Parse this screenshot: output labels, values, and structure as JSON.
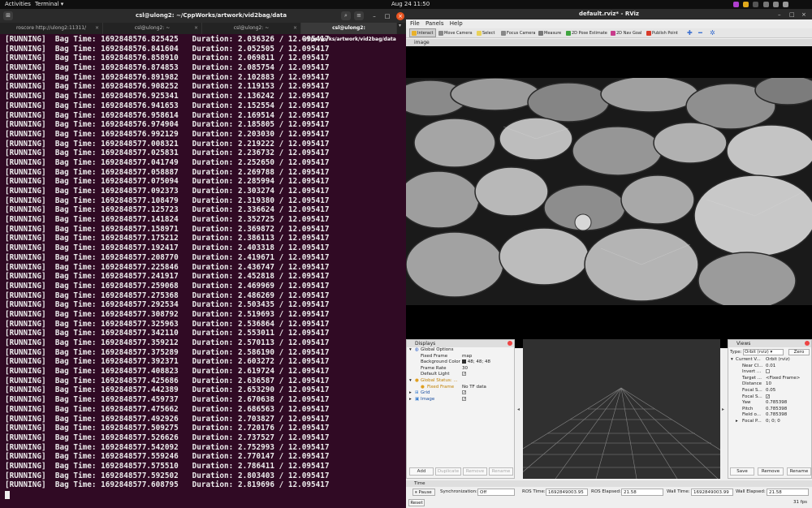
{
  "topbar": {
    "activities": "Activities",
    "app_menu": "Terminal ▾",
    "clock": "Aug 24  11:50"
  },
  "terminal": {
    "title": "csl@ulong2: ~/CppWorks/artwork/vid2bag/data",
    "tabs": [
      {
        "label": "roscore http://ulong2:11311/",
        "active": false
      },
      {
        "label": "csl@ulong2: ~",
        "active": false
      },
      {
        "label": "csl@ulong2: ~",
        "active": false
      },
      {
        "label": "csl@ulong2: ~/CppWorks/artwork/vid2bag/data",
        "active": true
      }
    ],
    "total_duration": "12.095417",
    "lines": [
      {
        "status": "[RUNNING]",
        "bag_time": "1692848576.825425",
        "duration": "2.036326"
      },
      {
        "status": "[RUNNING]",
        "bag_time": "1692848576.841604",
        "duration": "2.052505"
      },
      {
        "status": "[RUNNING]",
        "bag_time": "1692848576.858910",
        "duration": "2.069811"
      },
      {
        "status": "[RUNNING]",
        "bag_time": "1692848576.874853",
        "duration": "2.085754"
      },
      {
        "status": "[RUNNING]",
        "bag_time": "1692848576.891982",
        "duration": "2.102883"
      },
      {
        "status": "[RUNNING]",
        "bag_time": "1692848576.908252",
        "duration": "2.119153"
      },
      {
        "status": "[RUNNING]",
        "bag_time": "1692848576.925341",
        "duration": "2.136242"
      },
      {
        "status": "[RUNNING]",
        "bag_time": "1692848576.941653",
        "duration": "2.152554"
      },
      {
        "status": "[RUNNING]",
        "bag_time": "1692848576.958614",
        "duration": "2.169514"
      },
      {
        "status": "[RUNNING]",
        "bag_time": "1692848576.974904",
        "duration": "2.185805"
      },
      {
        "status": "[RUNNING]",
        "bag_time": "1692848576.992129",
        "duration": "2.203030"
      },
      {
        "status": "[RUNNING]",
        "bag_time": "1692848577.008321",
        "duration": "2.219222"
      },
      {
        "status": "[RUNNING]",
        "bag_time": "1692848577.025831",
        "duration": "2.236732"
      },
      {
        "status": "[RUNNING]",
        "bag_time": "1692848577.041749",
        "duration": "2.252650"
      },
      {
        "status": "[RUNNING]",
        "bag_time": "1692848577.058887",
        "duration": "2.269788"
      },
      {
        "status": "[RUNNING]",
        "bag_time": "1692848577.075094",
        "duration": "2.285994"
      },
      {
        "status": "[RUNNING]",
        "bag_time": "1692848577.092373",
        "duration": "2.303274"
      },
      {
        "status": "[RUNNING]",
        "bag_time": "1692848577.108479",
        "duration": "2.319380"
      },
      {
        "status": "[RUNNING]",
        "bag_time": "1692848577.125723",
        "duration": "2.336624"
      },
      {
        "status": "[RUNNING]",
        "bag_time": "1692848577.141824",
        "duration": "2.352725"
      },
      {
        "status": "[RUNNING]",
        "bag_time": "1692848577.158971",
        "duration": "2.369872"
      },
      {
        "status": "[RUNNING]",
        "bag_time": "1692848577.175212",
        "duration": "2.386113"
      },
      {
        "status": "[RUNNING]",
        "bag_time": "1692848577.192417",
        "duration": "2.403318"
      },
      {
        "status": "[RUNNING]",
        "bag_time": "1692848577.208770",
        "duration": "2.419671"
      },
      {
        "status": "[RUNNING]",
        "bag_time": "1692848577.225846",
        "duration": "2.436747"
      },
      {
        "status": "[RUNNING]",
        "bag_time": "1692848577.241917",
        "duration": "2.452818"
      },
      {
        "status": "[RUNNING]",
        "bag_time": "1692848577.259068",
        "duration": "2.469969"
      },
      {
        "status": "[RUNNING]",
        "bag_time": "1692848577.275368",
        "duration": "2.486269"
      },
      {
        "status": "[RUNNING]",
        "bag_time": "1692848577.292534",
        "duration": "2.503435"
      },
      {
        "status": "[RUNNING]",
        "bag_time": "1692848577.308792",
        "duration": "2.519693"
      },
      {
        "status": "[RUNNING]",
        "bag_time": "1692848577.325963",
        "duration": "2.536864"
      },
      {
        "status": "[RUNNING]",
        "bag_time": "1692848577.342110",
        "duration": "2.553011"
      },
      {
        "status": "[RUNNING]",
        "bag_time": "1692848577.359212",
        "duration": "2.570113"
      },
      {
        "status": "[RUNNING]",
        "bag_time": "1692848577.375289",
        "duration": "2.586190"
      },
      {
        "status": "[RUNNING]",
        "bag_time": "1692848577.392371",
        "duration": "2.603272"
      },
      {
        "status": "[RUNNING]",
        "bag_time": "1692848577.408823",
        "duration": "2.619724"
      },
      {
        "status": "[RUNNING]",
        "bag_time": "1692848577.425686",
        "duration": "2.636587"
      },
      {
        "status": "[RUNNING]",
        "bag_time": "1692848577.442389",
        "duration": "2.653290"
      },
      {
        "status": "[RUNNING]",
        "bag_time": "1692848577.459737",
        "duration": "2.670638"
      },
      {
        "status": "[RUNNING]",
        "bag_time": "1692848577.475662",
        "duration": "2.686563"
      },
      {
        "status": "[RUNNING]",
        "bag_time": "1692848577.492926",
        "duration": "2.703827"
      },
      {
        "status": "[RUNNING]",
        "bag_time": "1692848577.509275",
        "duration": "2.720176"
      },
      {
        "status": "[RUNNING]",
        "bag_time": "1692848577.526626",
        "duration": "2.737527"
      },
      {
        "status": "[RUNNING]",
        "bag_time": "1692848577.542092",
        "duration": "2.752993"
      },
      {
        "status": "[RUNNING]",
        "bag_time": "1692848577.559246",
        "duration": "2.770147"
      },
      {
        "status": "[RUNNING]",
        "bag_time": "1692848577.575510",
        "duration": "2.786411"
      },
      {
        "status": "[RUNNING]",
        "bag_time": "1692848577.592502",
        "duration": "2.803403"
      },
      {
        "status": "[RUNNING]",
        "bag_time": "1692848577.608795",
        "duration": "2.819696"
      }
    ]
  },
  "rviz": {
    "title": "default.rviz* - RViz",
    "menu": [
      "File",
      "Panels",
      "Help"
    ],
    "tools": [
      {
        "label": "Interact",
        "icon": "cursor-icon",
        "color": "#e9b12a"
      },
      {
        "label": "Move Camera",
        "icon": "move-camera-icon",
        "color": "#888888"
      },
      {
        "label": "Select",
        "icon": "select-icon",
        "color": "#e9d25a"
      },
      {
        "label": "Focus Camera",
        "icon": "focus-camera-icon",
        "color": "#888888"
      },
      {
        "label": "Measure",
        "icon": "ruler-icon",
        "color": "#777777"
      },
      {
        "label": "2D Pose Estimate",
        "icon": "pose-estimate-icon",
        "color": "#3fa43f"
      },
      {
        "label": "2D Nav Goal",
        "icon": "nav-goal-icon",
        "color": "#c83c8c"
      },
      {
        "label": "Publish Point",
        "icon": "publish-point-icon",
        "color": "#d83a2a"
      }
    ],
    "image_panel_title": "image",
    "displays": {
      "title": "Displays",
      "global_options": "Global Options",
      "fixed_frame_label": "Fixed Frame",
      "fixed_frame_value": "map",
      "background_label": "Background Color",
      "background_value": "48; 48; 48",
      "frame_rate_label": "Frame Rate",
      "frame_rate_value": "30",
      "default_light_label": "Default Light",
      "global_status": "Global Status: ...",
      "fixed_frame_status": "Fixed Frame",
      "fixed_frame_status_value": "No TF data",
      "grid": "Grid",
      "image": "Image",
      "buttons": {
        "add": "Add",
        "duplicate": "Duplicate",
        "remove": "Remove",
        "rename": "Rename"
      }
    },
    "views": {
      "title": "Views",
      "type_label": "Type:",
      "type_value": "Orbit (rviz)",
      "zero": "Zero",
      "current_view": "Current V...",
      "current_view_value": "Orbit (rviz)",
      "props": [
        {
          "k": "Near Cl...",
          "v": "0.01"
        },
        {
          "k": "Invert ...",
          "v": ""
        },
        {
          "k": "Target ...",
          "v": "<Fixed Frame>"
        },
        {
          "k": "Distance",
          "v": "10"
        },
        {
          "k": "Focal S...",
          "v": "0.05"
        },
        {
          "k": "Focal S...",
          "v": "✓"
        },
        {
          "k": "Yaw",
          "v": "0.785398"
        },
        {
          "k": "Pitch",
          "v": "0.785398"
        },
        {
          "k": "Field o...",
          "v": "0.785398"
        },
        {
          "k": "Focal P...",
          "v": "0; 0; 0"
        }
      ],
      "buttons": {
        "save": "Save",
        "remove": "Remove",
        "rename": "Rename"
      }
    },
    "time": {
      "title": "Time",
      "pause": "Pause",
      "sync_label": "Synchronization:",
      "sync_value": "Off",
      "ros_time_label": "ROS Time:",
      "ros_time_value": "1692849003.95",
      "ros_elapsed_label": "ROS Elapsed:",
      "ros_elapsed_value": "21.58",
      "wall_time_label": "Wall Time:",
      "wall_time_value": "1692849003.99",
      "wall_elapsed_label": "Wall Elapsed:",
      "wall_elapsed_value": "21.58",
      "reset": "Reset",
      "fps": "31 fps"
    }
  }
}
